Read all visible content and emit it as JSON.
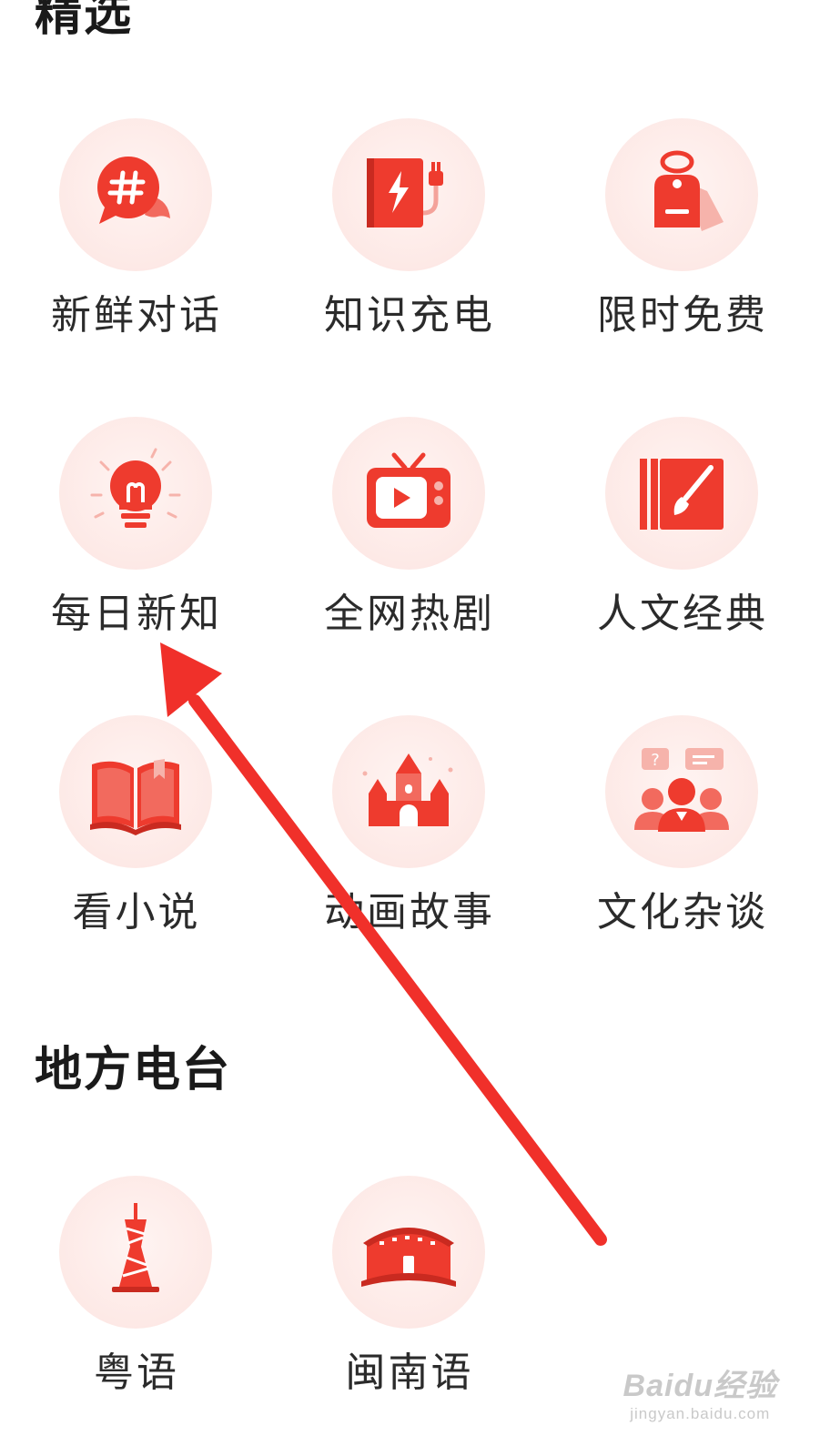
{
  "sections": {
    "featured": {
      "title": "精选"
    },
    "local": {
      "title": "地方电台"
    }
  },
  "featured_items": [
    {
      "label": "新鲜对话",
      "icon": "chat-hashtag-icon"
    },
    {
      "label": "知识充电",
      "icon": "book-charger-icon"
    },
    {
      "label": "限时免费",
      "icon": "price-tag-icon"
    },
    {
      "label": "每日新知",
      "icon": "light-bulb-icon"
    },
    {
      "label": "全网热剧",
      "icon": "tv-play-icon"
    },
    {
      "label": "人文经典",
      "icon": "book-brush-icon"
    },
    {
      "label": "看小说",
      "icon": "open-book-icon"
    },
    {
      "label": "动画故事",
      "icon": "castle-icon"
    },
    {
      "label": "文化杂谈",
      "icon": "discussion-people-icon"
    }
  ],
  "local_items": [
    {
      "label": "粤语",
      "icon": "canton-tower-icon"
    },
    {
      "label": "闽南语",
      "icon": "tulou-building-icon"
    }
  ],
  "watermark": {
    "brand": "Baidu经验",
    "url": "jingyan.baidu.com"
  },
  "colors": {
    "accent": "#ee3b2e",
    "icon_circle": "#fde9e6",
    "arrow": "#f0302a"
  }
}
